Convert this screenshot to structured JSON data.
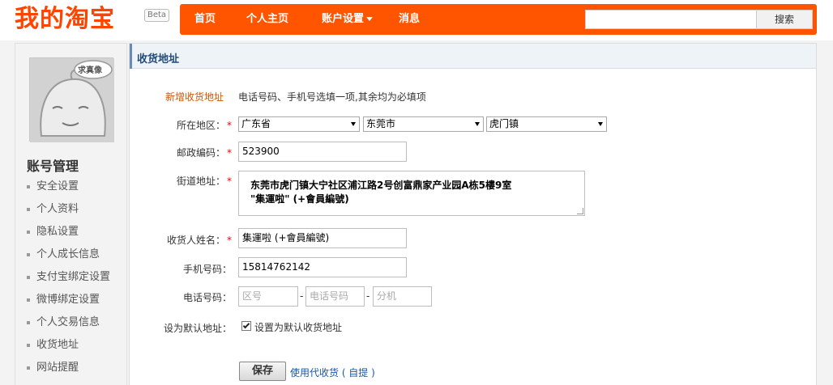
{
  "header": {
    "logo": "我的淘宝",
    "beta": "Beta",
    "nav": [
      {
        "label": "首页"
      },
      {
        "label": "个人主页"
      },
      {
        "label": "账户设置"
      },
      {
        "label": "消息"
      }
    ],
    "search_button": "搜索",
    "search_value": ""
  },
  "sidebar": {
    "avatar_badge": "求真像",
    "title": "账号管理",
    "items": [
      {
        "label": "安全设置"
      },
      {
        "label": "个人资料"
      },
      {
        "label": "隐私设置"
      },
      {
        "label": "个人成长信息"
      },
      {
        "label": "支付宝绑定设置"
      },
      {
        "label": "微博绑定设置"
      },
      {
        "label": "个人交易信息"
      },
      {
        "label": "收货地址"
      },
      {
        "label": "网站提醒"
      }
    ]
  },
  "main": {
    "panel_title": "收货地址",
    "new_address": "新增收货地址",
    "tip": "电话号码、手机号选填一项,其余均为必填项",
    "labels": {
      "region": "所在地区：",
      "postcode": "邮政编码：",
      "street": "街道地址：",
      "name": "收货人姓名：",
      "mobile": "手机号码：",
      "phone": "电话号码：",
      "default": "设为默认地址："
    },
    "required_mark": "*",
    "region": {
      "province": "广东省",
      "city": "东莞市",
      "district": "虎门镇"
    },
    "postcode": "523900",
    "street_line1": "东莞市虎门镇大宁社区浦江路2号创富鼎家产业园A栋5樓9室",
    "street_line2": "\"集運啦\" (+會員編號)",
    "receiver_name": "集運啦 (+會員編號)",
    "mobile": "15814762142",
    "phone": {
      "area_placeholder": "区号",
      "number_placeholder": "电话号码",
      "ext_placeholder": "分机",
      "separator": "-"
    },
    "default_checkbox_label": "设置为默认收货地址",
    "save_button": "保存",
    "agent_link": "使用代收货 ( 自提 )"
  }
}
